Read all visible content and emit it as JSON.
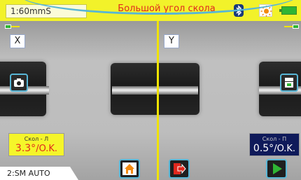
{
  "topbar": {
    "mode": "1:60mmS",
    "title": "Большой угол скола"
  },
  "views": {
    "left_label": "X",
    "right_label": "Y"
  },
  "cleave_left": {
    "label": "Скол - Л",
    "value": "3.3°",
    "status": "/O.K."
  },
  "cleave_right": {
    "label": "Скол - П",
    "value": "0.5°",
    "status": "/O.K."
  },
  "bottom": {
    "program": "2:SM AUTO"
  },
  "colors": {
    "topbar": "#f2f22a",
    "title_text": "#e0281e",
    "accent_border": "#58b6d6",
    "cleave_left_bg": "#f5f52a",
    "cleave_left_value": "#e0281e",
    "cleave_right_bg": "#0f1a5a"
  },
  "icons": {
    "bluetooth": "bluetooth-icon",
    "brightness": "sun-icon",
    "battery": "battery-icon",
    "camera": "camera-icon",
    "stats": "stats-icon",
    "home": "home-icon",
    "exit": "exit-icon",
    "play": "play-icon"
  }
}
